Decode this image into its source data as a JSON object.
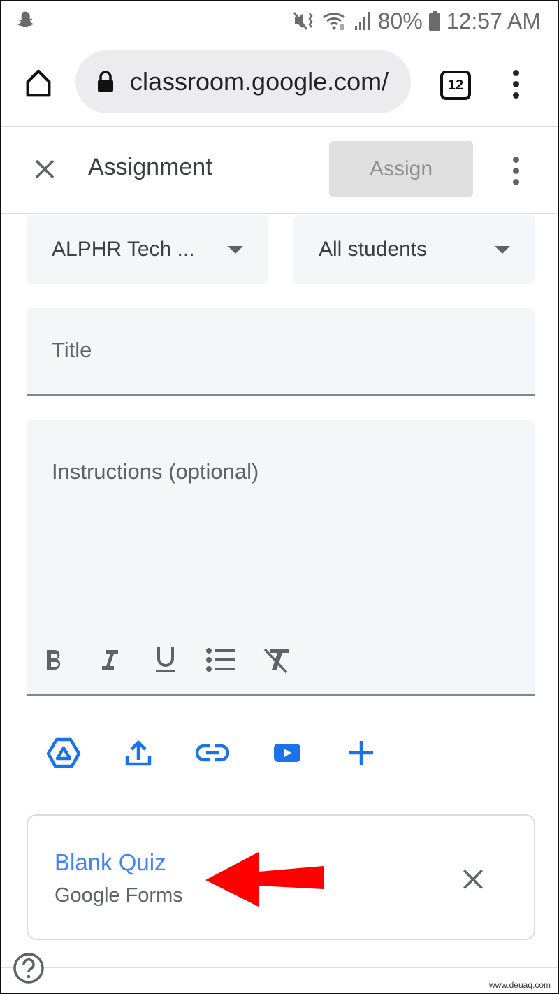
{
  "status_bar": {
    "notification_icon": "snapchat-ghost-icon",
    "icons": [
      "mute-vibrate-icon",
      "wifi-icon",
      "signal-icon"
    ],
    "battery": "80%",
    "time": "12:57 AM"
  },
  "browser": {
    "url": "classroom.google.com/",
    "tab_count": "12",
    "home_icon": "home-icon",
    "lock_icon": "lock-icon",
    "menu_icon": "more-vert-icon"
  },
  "header": {
    "title": "Assignment",
    "assign_label": "Assign",
    "close_icon": "close-icon",
    "menu_icon": "more-vert-icon"
  },
  "form": {
    "class_select": "ALPHR Tech ...",
    "students_select": "All students",
    "title_placeholder": "Title",
    "instructions_placeholder": "Instructions (optional)",
    "format_buttons": [
      "bold",
      "italic",
      "underline",
      "bulleted-list",
      "clear-formatting"
    ],
    "attach_buttons": [
      "google-drive",
      "upload",
      "link",
      "youtube",
      "create"
    ]
  },
  "attachment": {
    "title": "Blank Quiz",
    "subtitle": "Google Forms",
    "remove_icon": "close-icon"
  },
  "annotation": {
    "arrow_color": "#ff0000"
  },
  "footer": {
    "help_icon": "help-icon",
    "watermark": "www.deuaq.com"
  },
  "colors": {
    "accent_blue": "#1a73e8",
    "link_blue": "#4285f4",
    "icon_gray": "#5f6368"
  }
}
